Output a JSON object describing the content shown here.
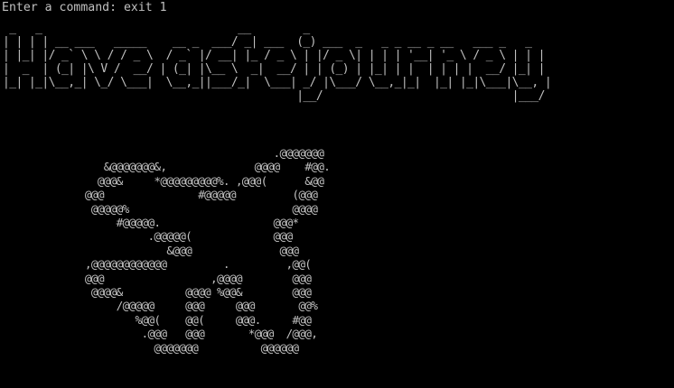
{
  "colors": {
    "background": "#000000",
    "foreground": "#c0c0c0"
  },
  "terminal": {
    "prompt_label": "Enter a command: ",
    "command_input": "exit 1",
    "banner": [
      " _   _                              __        _                                          ",
      "| | | | __ ___   _____    __ _  ___/ _| ___  (_) ___  _   _ _ __ _ __   ___ _   _        ",
      "| |_| |/ _` \\ \\ / / _ \\  / _` |/ __| |_ / _ \\ | |/ _ \\| | | | '__| '_ \\ / _ \\ | | |       ",
      "|  _  | (_| |\\ V /  __/ | (_| |\\__ \\  _|  __/ | | (_) | |_| | |  | | | |  __/ |_| |       ",
      "|_| |_|\\__,_| \\_/ \\___|  \\__,_||___/_|  \\___| _/ |\\___/ \\__,_|_|  |_| |_|\\___|\\__, |       ",
      "                                             |__/                             |___/        "
    ],
    "art": [
      "                                .@@@@@@@",
      "     &@@@@@@@&,              @@@@    #@@.",
      "    @@@&     *@@@@@@@@@%. ,@@@(      &@@",
      "  @@@               #@@@@@         (@@@",
      "   @@@@@%                          @@@@",
      "       #@@@@@.                  @@@*",
      "            .@@@@@(             @@@",
      "               &@@@              @@@",
      "  ,@@@@@@@@@@@@         .         ,@@(",
      "  @@@                 ,@@@@        @@@",
      "   @@@@&          @@@@ %@@&        @@@",
      "       /@@@@@     @@@     @@@       @@%",
      "          %@@(    @@(     @@@.     #@@",
      "           .@@@   @@@       *@@@  /@@@,",
      "             @@@@@@@          @@@@@@"
    ]
  }
}
